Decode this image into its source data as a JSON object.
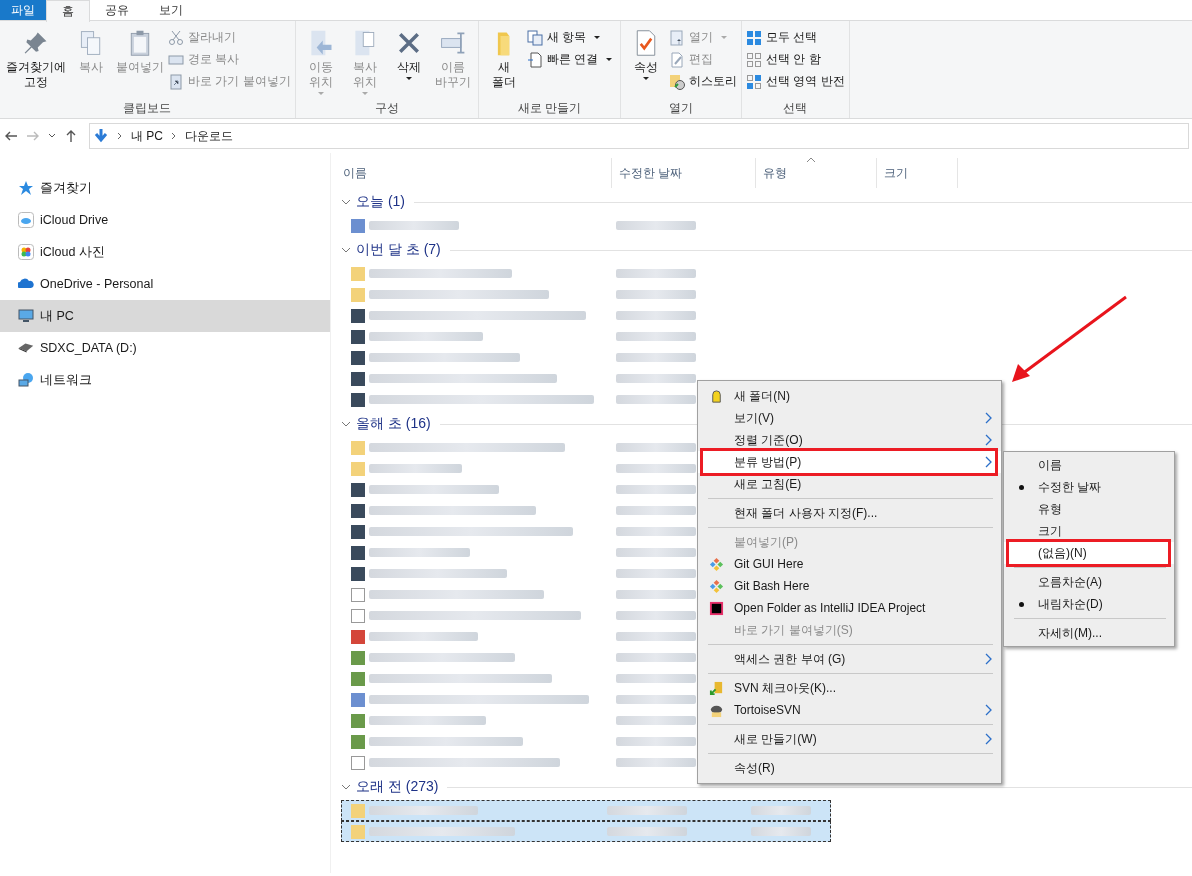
{
  "ribbon_tabs": [
    {
      "label": "파일",
      "kind": "file",
      "selected": false
    },
    {
      "label": "홈",
      "kind": "tab",
      "selected": true
    },
    {
      "label": "공유",
      "kind": "tab",
      "selected": false
    },
    {
      "label": "보기",
      "kind": "tab",
      "selected": false
    }
  ],
  "ribbon_groups": [
    {
      "label": "클립보드",
      "buttons": [
        {
          "kind": "large",
          "label": "즐겨찾기에\n고정",
          "disabled": false,
          "dropdown": false
        },
        {
          "kind": "large",
          "label": "복사",
          "disabled": true,
          "dropdown": false
        },
        {
          "kind": "large",
          "label": "붙여넣기",
          "disabled": true,
          "dropdown": false
        },
        {
          "kind": "small",
          "label": "잘라내기",
          "disabled": true,
          "dropdown": false
        },
        {
          "kind": "small",
          "label": "경로 복사",
          "disabled": true,
          "dropdown": false
        },
        {
          "kind": "small",
          "label": "바로 가기 붙여넣기",
          "disabled": true,
          "dropdown": false
        }
      ]
    },
    {
      "label": "구성",
      "buttons": [
        {
          "kind": "large",
          "label": "이동\n위치",
          "disabled": true,
          "dropdown": true
        },
        {
          "kind": "large",
          "label": "복사\n위치",
          "disabled": true,
          "dropdown": true
        },
        {
          "kind": "large",
          "label": "삭제",
          "disabled": false,
          "dropdown": true
        },
        {
          "kind": "large",
          "label": "이름\n바꾸기",
          "disabled": true,
          "dropdown": false
        }
      ]
    },
    {
      "label": "새로 만들기",
      "buttons": [
        {
          "kind": "large",
          "label": "새\n폴더",
          "disabled": false,
          "dropdown": false
        },
        {
          "kind": "small",
          "label": "새 항목",
          "disabled": false,
          "dropdown": true
        },
        {
          "kind": "small",
          "label": "빠른 연결",
          "disabled": false,
          "dropdown": true
        }
      ]
    },
    {
      "label": "열기",
      "buttons": [
        {
          "kind": "large",
          "label": "속성",
          "disabled": false,
          "dropdown": true
        },
        {
          "kind": "small",
          "label": "열기",
          "disabled": true,
          "dropdown": true
        },
        {
          "kind": "small",
          "label": "편집",
          "disabled": true,
          "dropdown": false
        },
        {
          "kind": "small",
          "label": "히스토리",
          "disabled": false,
          "dropdown": false
        }
      ]
    },
    {
      "label": "선택",
      "buttons": [
        {
          "kind": "small",
          "label": "모두 선택",
          "disabled": false,
          "dropdown": false
        },
        {
          "kind": "small",
          "label": "선택 안 함",
          "disabled": false,
          "dropdown": false
        },
        {
          "kind": "small",
          "label": "선택 영역 반전",
          "disabled": false,
          "dropdown": false
        }
      ]
    }
  ],
  "address": {
    "path": [
      "내 PC",
      "다운로드"
    ]
  },
  "sidebar": {
    "items": [
      {
        "label": "즐겨찾기",
        "selected": false
      },
      {
        "label": "iCloud Drive",
        "selected": false
      },
      {
        "label": "iCloud 사진",
        "selected": false
      },
      {
        "label": "OneDrive - Personal",
        "selected": false
      },
      {
        "label": "내 PC",
        "selected": true
      },
      {
        "label": "SDXC_DATA (D:)",
        "selected": false
      },
      {
        "label": "네트워크",
        "selected": false
      }
    ]
  },
  "columns": [
    {
      "label": "이름",
      "sorted": false
    },
    {
      "label": "수정한 날짜",
      "sorted": false
    },
    {
      "label": "유형",
      "sorted": true
    },
    {
      "label": "크기",
      "sorted": false
    }
  ],
  "groups": [
    {
      "label": "오늘 (1)",
      "rows": [
        {
          "kind": "setup",
          "selected": false
        }
      ]
    },
    {
      "label": "이번 달 초 (7)",
      "rows": [
        {
          "kind": "folder",
          "selected": false
        },
        {
          "kind": "folder",
          "selected": false
        },
        {
          "kind": "archive",
          "selected": false
        },
        {
          "kind": "archive",
          "selected": false
        },
        {
          "kind": "archive",
          "selected": false
        },
        {
          "kind": "archive",
          "selected": false
        },
        {
          "kind": "archive",
          "selected": false
        }
      ]
    },
    {
      "label": "올해 초 (16)",
      "rows": [
        {
          "kind": "folder",
          "selected": false
        },
        {
          "kind": "folder",
          "selected": false
        },
        {
          "kind": "archive",
          "selected": false
        },
        {
          "kind": "archive",
          "selected": false
        },
        {
          "kind": "archive",
          "selected": false
        },
        {
          "kind": "archive",
          "selected": false
        },
        {
          "kind": "archive",
          "selected": false
        },
        {
          "kind": "document",
          "selected": false
        },
        {
          "kind": "document",
          "selected": false
        },
        {
          "kind": "pdf",
          "selected": false
        },
        {
          "kind": "program",
          "selected": false
        },
        {
          "kind": "program",
          "selected": false
        },
        {
          "kind": "setup",
          "selected": false
        },
        {
          "kind": "program",
          "selected": false
        },
        {
          "kind": "program",
          "selected": false
        },
        {
          "kind": "text",
          "selected": false
        }
      ]
    },
    {
      "label": "오래 전 (273)",
      "rows": [
        {
          "kind": "folder",
          "selected": true
        },
        {
          "kind": "folder",
          "selected": true
        }
      ]
    }
  ],
  "context_menu": {
    "items": [
      {
        "kind": "item",
        "label": "새 폴더(N)",
        "disabled": false,
        "submenu": false,
        "highlighted": false
      },
      {
        "kind": "item",
        "label": "보기(V)",
        "disabled": false,
        "submenu": true,
        "highlighted": false
      },
      {
        "kind": "item",
        "label": "정렬 기준(O)",
        "disabled": false,
        "submenu": true,
        "highlighted": false
      },
      {
        "kind": "item",
        "label": "분류 방법(P)",
        "disabled": false,
        "submenu": true,
        "highlighted": true
      },
      {
        "kind": "item",
        "label": "새로 고침(E)",
        "disabled": false,
        "submenu": false,
        "highlighted": false
      },
      {
        "kind": "separator"
      },
      {
        "kind": "item",
        "label": "현재 폴더 사용자 지정(F)...",
        "disabled": false,
        "submenu": false,
        "highlighted": false
      },
      {
        "kind": "separator"
      },
      {
        "kind": "item",
        "label": "붙여넣기(P)",
        "disabled": true,
        "submenu": false,
        "highlighted": false
      },
      {
        "kind": "item",
        "label": "Git GUI Here",
        "disabled": false,
        "submenu": false,
        "highlighted": false
      },
      {
        "kind": "item",
        "label": "Git Bash Here",
        "disabled": false,
        "submenu": false,
        "highlighted": false
      },
      {
        "kind": "item",
        "label": "Open Folder as IntelliJ IDEA Project",
        "disabled": false,
        "submenu": false,
        "highlighted": false
      },
      {
        "kind": "item",
        "label": "바로 가기 붙여넣기(S)",
        "disabled": true,
        "submenu": false,
        "highlighted": false
      },
      {
        "kind": "separator"
      },
      {
        "kind": "item",
        "label": "액세스 권한 부여 (G)",
        "disabled": false,
        "submenu": true,
        "highlighted": false
      },
      {
        "kind": "separator"
      },
      {
        "kind": "item",
        "label": "SVN 체크아웃(K)...",
        "disabled": false,
        "submenu": false,
        "highlighted": false
      },
      {
        "kind": "item",
        "label": "TortoiseSVN",
        "disabled": false,
        "submenu": true,
        "highlighted": false
      },
      {
        "kind": "separator"
      },
      {
        "kind": "item",
        "label": "새로 만들기(W)",
        "disabled": false,
        "submenu": true,
        "highlighted": false
      },
      {
        "kind": "separator"
      },
      {
        "kind": "item",
        "label": "속성(R)",
        "disabled": false,
        "submenu": false,
        "highlighted": false
      }
    ]
  },
  "submenu": {
    "items": [
      {
        "kind": "item",
        "label": "이름",
        "checked": false,
        "highlighted": false
      },
      {
        "kind": "item",
        "label": "수정한 날짜",
        "checked": true,
        "highlighted": false
      },
      {
        "kind": "item",
        "label": "유형",
        "checked": false,
        "highlighted": false
      },
      {
        "kind": "item",
        "label": "크기",
        "checked": false,
        "highlighted": false
      },
      {
        "kind": "item",
        "label": "(없음)(N)",
        "checked": false,
        "highlighted": true
      },
      {
        "kind": "separator"
      },
      {
        "kind": "item",
        "label": "오름차순(A)",
        "checked": false,
        "highlighted": false
      },
      {
        "kind": "item",
        "label": "내림차순(D)",
        "checked": true,
        "highlighted": false
      },
      {
        "kind": "separator"
      },
      {
        "kind": "item",
        "label": "자세히(M)...",
        "checked": false,
        "highlighted": false
      }
    ]
  },
  "annotation_arrow": true
}
